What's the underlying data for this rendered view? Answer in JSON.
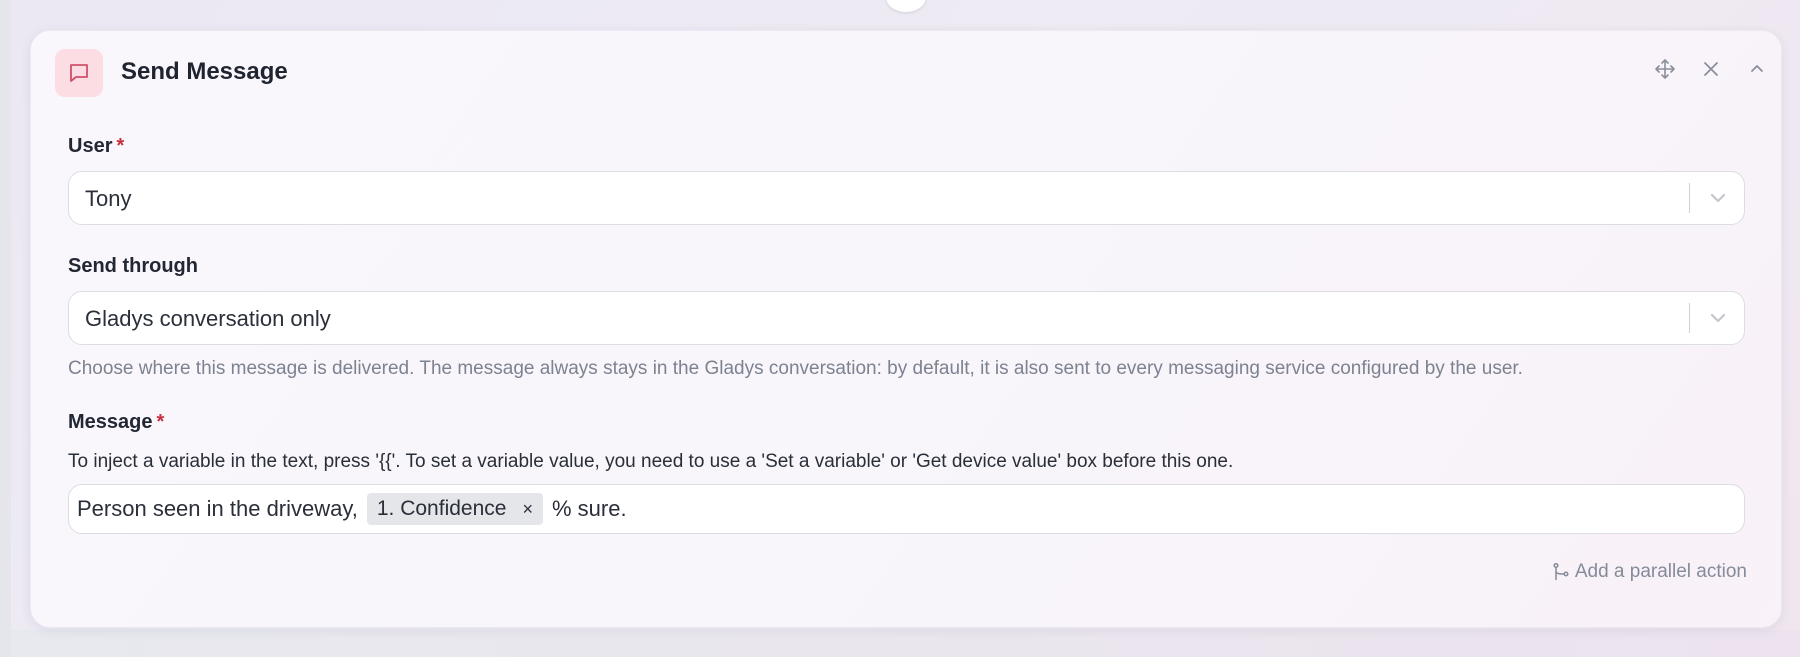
{
  "card": {
    "title": "Send Message",
    "icons": {
      "header": "message-square-icon",
      "move": "move-icon",
      "close": "close-icon",
      "collapse": "chevron-up-icon"
    }
  },
  "user_field": {
    "label": "User",
    "required_mark": "*",
    "value": "Tony"
  },
  "send_through_field": {
    "label": "Send through",
    "value": "Gladys conversation only",
    "help": "Choose where this message is delivered. The message always stays in the Gladys conversation: by default, it is also sent to every messaging service configured by the user."
  },
  "message_field": {
    "label": "Message",
    "required_mark": "*",
    "hint": "To inject a variable in the text, press '{{'. To set a variable value, you need to use a 'Set a variable' or 'Get device value' box before this one.",
    "text_before": "Person seen in the driveway,",
    "variable_chip": "1. Confidence",
    "chip_remove": "×",
    "text_after": "% sure."
  },
  "footer": {
    "add_parallel_label": "Add a parallel action"
  },
  "colors": {
    "accent_icon_bg": "#fbdde3",
    "accent_icon_stroke": "#d0506a",
    "required": "#c62f3d"
  }
}
